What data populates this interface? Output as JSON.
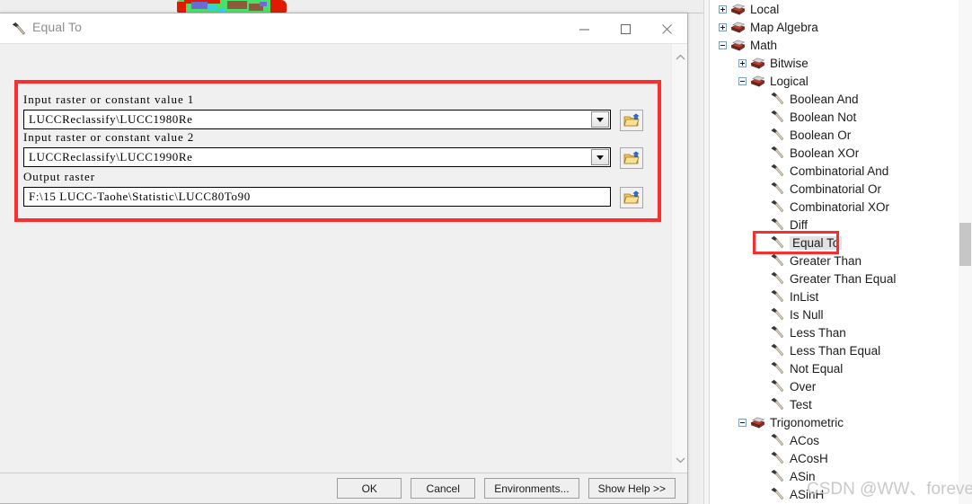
{
  "dialog": {
    "title": "Equal To",
    "title_icon": "hammer-tool-icon",
    "window_controls": {
      "minimize": "minimize-icon",
      "maximize": "maximize-icon",
      "close": "close-icon"
    },
    "params": [
      {
        "label": "Input raster or constant value 1",
        "value": "LUCCReclassify\\LUCC1980Re",
        "type": "combobox",
        "browse_icon": "open-folder-icon"
      },
      {
        "label": "Input raster or constant value 2",
        "value": "LUCCReclassify\\LUCC1990Re",
        "type": "combobox",
        "browse_icon": "open-folder-icon"
      },
      {
        "label": "Output raster",
        "value": "F:\\15 LUCC-Taohe\\Statistic\\LUCC80To90",
        "type": "textbox",
        "browse_icon": "open-folder-icon"
      }
    ],
    "buttons": [
      {
        "label": "OK",
        "name": "ok-button"
      },
      {
        "label": "Cancel",
        "name": "cancel-button"
      },
      {
        "label": "Environments...",
        "name": "environments-button"
      },
      {
        "label": "Show Help >>",
        "name": "show-help-button"
      }
    ],
    "scrollbar": {
      "up_arrow": "chevron-up-icon",
      "down_arrow": "chevron-down-icon"
    }
  },
  "toolbox_tree": {
    "items": [
      {
        "label": "Local",
        "depth": 0,
        "expander": "plus",
        "icon": "toolbox-icon"
      },
      {
        "label": "Map Algebra",
        "depth": 0,
        "expander": "plus",
        "icon": "toolbox-icon"
      },
      {
        "label": "Math",
        "depth": 0,
        "expander": "minus",
        "icon": "toolbox-icon"
      },
      {
        "label": "Bitwise",
        "depth": 1,
        "expander": "plus",
        "icon": "toolbox-icon"
      },
      {
        "label": "Logical",
        "depth": 1,
        "expander": "minus",
        "icon": "toolbox-icon"
      },
      {
        "label": "Boolean And",
        "depth": 2,
        "expander": "none",
        "icon": "hammer-tool-icon"
      },
      {
        "label": "Boolean Not",
        "depth": 2,
        "expander": "none",
        "icon": "hammer-tool-icon"
      },
      {
        "label": "Boolean Or",
        "depth": 2,
        "expander": "none",
        "icon": "hammer-tool-icon"
      },
      {
        "label": "Boolean XOr",
        "depth": 2,
        "expander": "none",
        "icon": "hammer-tool-icon"
      },
      {
        "label": "Combinatorial And",
        "depth": 2,
        "expander": "none",
        "icon": "hammer-tool-icon"
      },
      {
        "label": "Combinatorial Or",
        "depth": 2,
        "expander": "none",
        "icon": "hammer-tool-icon"
      },
      {
        "label": "Combinatorial XOr",
        "depth": 2,
        "expander": "none",
        "icon": "hammer-tool-icon"
      },
      {
        "label": "Diff",
        "depth": 2,
        "expander": "none",
        "icon": "hammer-tool-icon"
      },
      {
        "label": "Equal To",
        "depth": 2,
        "expander": "none",
        "icon": "hammer-tool-icon",
        "selected": true,
        "highlighted": true
      },
      {
        "label": "Greater Than",
        "depth": 2,
        "expander": "none",
        "icon": "hammer-tool-icon"
      },
      {
        "label": "Greater Than Equal",
        "depth": 2,
        "expander": "none",
        "icon": "hammer-tool-icon"
      },
      {
        "label": "InList",
        "depth": 2,
        "expander": "none",
        "icon": "hammer-tool-icon"
      },
      {
        "label": "Is Null",
        "depth": 2,
        "expander": "none",
        "icon": "hammer-tool-icon"
      },
      {
        "label": "Less Than",
        "depth": 2,
        "expander": "none",
        "icon": "hammer-tool-icon"
      },
      {
        "label": "Less Than Equal",
        "depth": 2,
        "expander": "none",
        "icon": "hammer-tool-icon"
      },
      {
        "label": "Not Equal",
        "depth": 2,
        "expander": "none",
        "icon": "hammer-tool-icon"
      },
      {
        "label": "Over",
        "depth": 2,
        "expander": "none",
        "icon": "hammer-tool-icon"
      },
      {
        "label": "Test",
        "depth": 2,
        "expander": "none",
        "icon": "hammer-tool-icon"
      },
      {
        "label": "Trigonometric",
        "depth": 1,
        "expander": "minus",
        "icon": "toolbox-icon"
      },
      {
        "label": "ACos",
        "depth": 2,
        "expander": "none",
        "icon": "hammer-tool-icon"
      },
      {
        "label": "ACosH",
        "depth": 2,
        "expander": "none",
        "icon": "hammer-tool-icon"
      },
      {
        "label": "ASin",
        "depth": 2,
        "expander": "none",
        "icon": "hammer-tool-icon"
      },
      {
        "label": "ASinH",
        "depth": 2,
        "expander": "none",
        "icon": "hammer-tool-icon"
      }
    ]
  },
  "watermark": {
    "text": "CSDN @WW、forever"
  },
  "colors": {
    "annotation_red": "#fb2e2e",
    "selection_gray": "#e2e2e2",
    "map_green": "#49e06a",
    "map_red": "#e01b00"
  }
}
